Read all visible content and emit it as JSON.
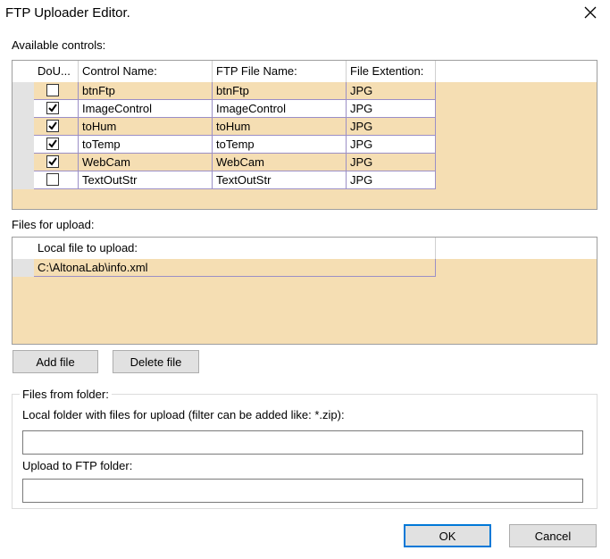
{
  "window": {
    "title": "FTP Uploader Editor."
  },
  "controls_section": {
    "label": "Available controls:",
    "columns": [
      "DoU...",
      "Control Name:",
      "FTP File Name:",
      "File Extention:"
    ],
    "rows": [
      {
        "checked": false,
        "control_name": "btnFtp",
        "ftp_file_name": "btnFtp",
        "extension": "JPG"
      },
      {
        "checked": true,
        "control_name": "ImageControl",
        "ftp_file_name": "ImageControl",
        "extension": "JPG"
      },
      {
        "checked": true,
        "control_name": "toHum",
        "ftp_file_name": "toHum",
        "extension": "JPG"
      },
      {
        "checked": true,
        "control_name": "toTemp",
        "ftp_file_name": "toTemp",
        "extension": "JPG"
      },
      {
        "checked": true,
        "control_name": "WebCam",
        "ftp_file_name": "WebCam",
        "extension": "JPG"
      },
      {
        "checked": false,
        "control_name": "TextOutStr",
        "ftp_file_name": "TextOutStr",
        "extension": "JPG"
      }
    ]
  },
  "files_section": {
    "label": "Files for upload:",
    "column": "Local file to upload:",
    "rows": [
      {
        "path": "C:\\AltonaLab\\info.xml"
      }
    ]
  },
  "buttons": {
    "add_file": "Add file",
    "delete_file": "Delete file",
    "ok": "OK",
    "cancel": "Cancel"
  },
  "folder_group": {
    "title": "Files from folder:",
    "local_folder_label": "Local folder with files for upload (filter can be added like: *.zip):",
    "local_folder_value": "",
    "ftp_folder_label": "Upload to FTP folder:",
    "ftp_folder_value": ""
  },
  "colors": {
    "grid_bg": "#f5deb3",
    "accent": "#0078d7"
  }
}
